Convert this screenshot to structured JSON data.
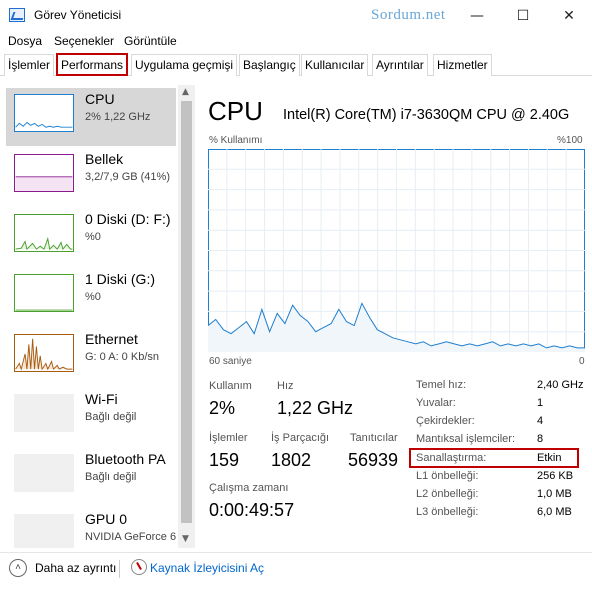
{
  "window": {
    "title": "Görev Yöneticisi",
    "watermark": "Sordum.net",
    "minimize_glyph": "—",
    "maximize_glyph": "☐",
    "close_glyph": "✕"
  },
  "menu": [
    "Dosya",
    "Seçenekler",
    "Görüntüle"
  ],
  "tabs": [
    {
      "label": "İşlemler"
    },
    {
      "label": "Performans",
      "active": true
    },
    {
      "label": "Uygulama geçmişi"
    },
    {
      "label": "Başlangıç"
    },
    {
      "label": "Kullanıcılar"
    },
    {
      "label": "Ayrıntılar"
    },
    {
      "label": "Hizmetler"
    }
  ],
  "sidebar": {
    "items": [
      {
        "name": "CPU",
        "sub": "2% 1,22 GHz",
        "color": "#1e7fd0",
        "selected": true
      },
      {
        "name": "Bellek",
        "sub": "3,2/7,9 GB (41%)",
        "color": "#8b1a8e"
      },
      {
        "name": "0 Diski (D: F:)",
        "sub": "%0",
        "color": "#4aa02c"
      },
      {
        "name": "1 Diski (G:)",
        "sub": "%0",
        "color": "#4aa02c"
      },
      {
        "name": "Ethernet",
        "sub": "G: 0 A: 0 Kb/sn",
        "color": "#a75c12"
      },
      {
        "name": "Wi-Fi",
        "sub": "Bağlı değil",
        "color": "#a75c12"
      },
      {
        "name": "Bluetooth PA",
        "sub": "Bağlı değil",
        "color": "#a75c12"
      },
      {
        "name": "GPU 0",
        "sub": "NVIDIA GeForce 6",
        "color": "#1e7fd0"
      }
    ]
  },
  "main": {
    "title": "CPU",
    "model": "Intel(R) Core(TM) i7-3630QM CPU @ 2.40G",
    "graph_label_left": "% Kullanımı",
    "graph_label_right": "%100",
    "axis_left": "60 saniye",
    "axis_right": "0",
    "accent": "#1e7fd0",
    "stats": {
      "usage_label": "Kullanım",
      "usage_value": "2%",
      "speed_label": "Hız",
      "speed_value": "1,22 GHz",
      "processes_label": "İşlemler",
      "processes_value": "159",
      "threads_label": "İş Parçacığı",
      "threads_value": "1802",
      "handles_label": "Tanıtıcılar",
      "handles_value": "56939",
      "uptime_label": "Çalışma zamanı",
      "uptime_value": "0:00:49:57"
    },
    "details": [
      {
        "label": "Temel hız:",
        "value": "2,40 GHz"
      },
      {
        "label": "Yuvalar:",
        "value": "1"
      },
      {
        "label": "Çekirdekler:",
        "value": "4"
      },
      {
        "label": "Mantıksal işlemciler:",
        "value": "8"
      },
      {
        "label": "Sanallaştırma:",
        "value": "Etkin"
      },
      {
        "label": "L1 önbelleği:",
        "value": "256 KB"
      },
      {
        "label": "L2 önbelleği:",
        "value": "1,0 MB"
      },
      {
        "label": "L3 önbelleği:",
        "value": "6,0 MB"
      }
    ],
    "cpu_history_percent": [
      13,
      16,
      11,
      9,
      12,
      15,
      9,
      21,
      10,
      19,
      14,
      23,
      18,
      15,
      10,
      12,
      14,
      21,
      15,
      13,
      24,
      17,
      11,
      9,
      7,
      6,
      5,
      4,
      5,
      3,
      4,
      5,
      4,
      3,
      4,
      3,
      4,
      5,
      3,
      4,
      3,
      4,
      3,
      4,
      2,
      3,
      2,
      3,
      2,
      2
    ]
  },
  "footer": {
    "less_details": "Daha az ayrıntı",
    "open_monitor": "Kaynak İzleyicisini Aç"
  }
}
